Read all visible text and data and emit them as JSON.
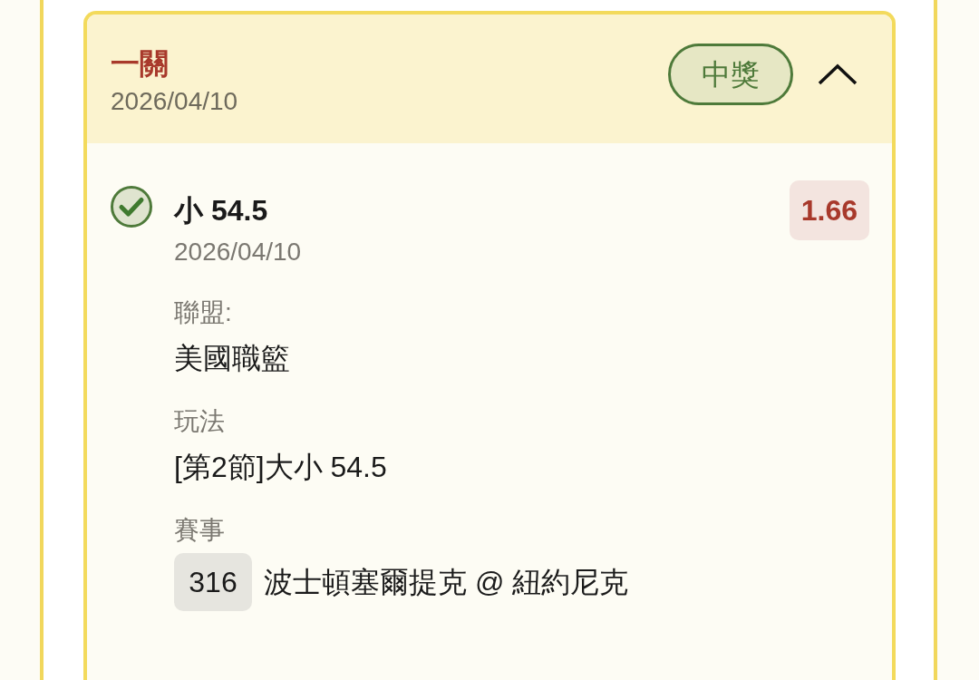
{
  "bet_card": {
    "title": "一關",
    "date": "2026/04/10",
    "status_badge": "中獎",
    "expanded": true,
    "selections": [
      {
        "won": true,
        "pick": "小 54.5",
        "odds": "1.66",
        "date": "2026/04/10",
        "fields": [
          {
            "label": "聯盟:",
            "value": "美國職籃"
          },
          {
            "label": "玩法",
            "value": "[第2節]大小 54.5"
          },
          {
            "label": "賽事",
            "event_number": "316",
            "value": "波士頓塞爾提克 @ 紐約尼克"
          }
        ]
      }
    ]
  }
}
